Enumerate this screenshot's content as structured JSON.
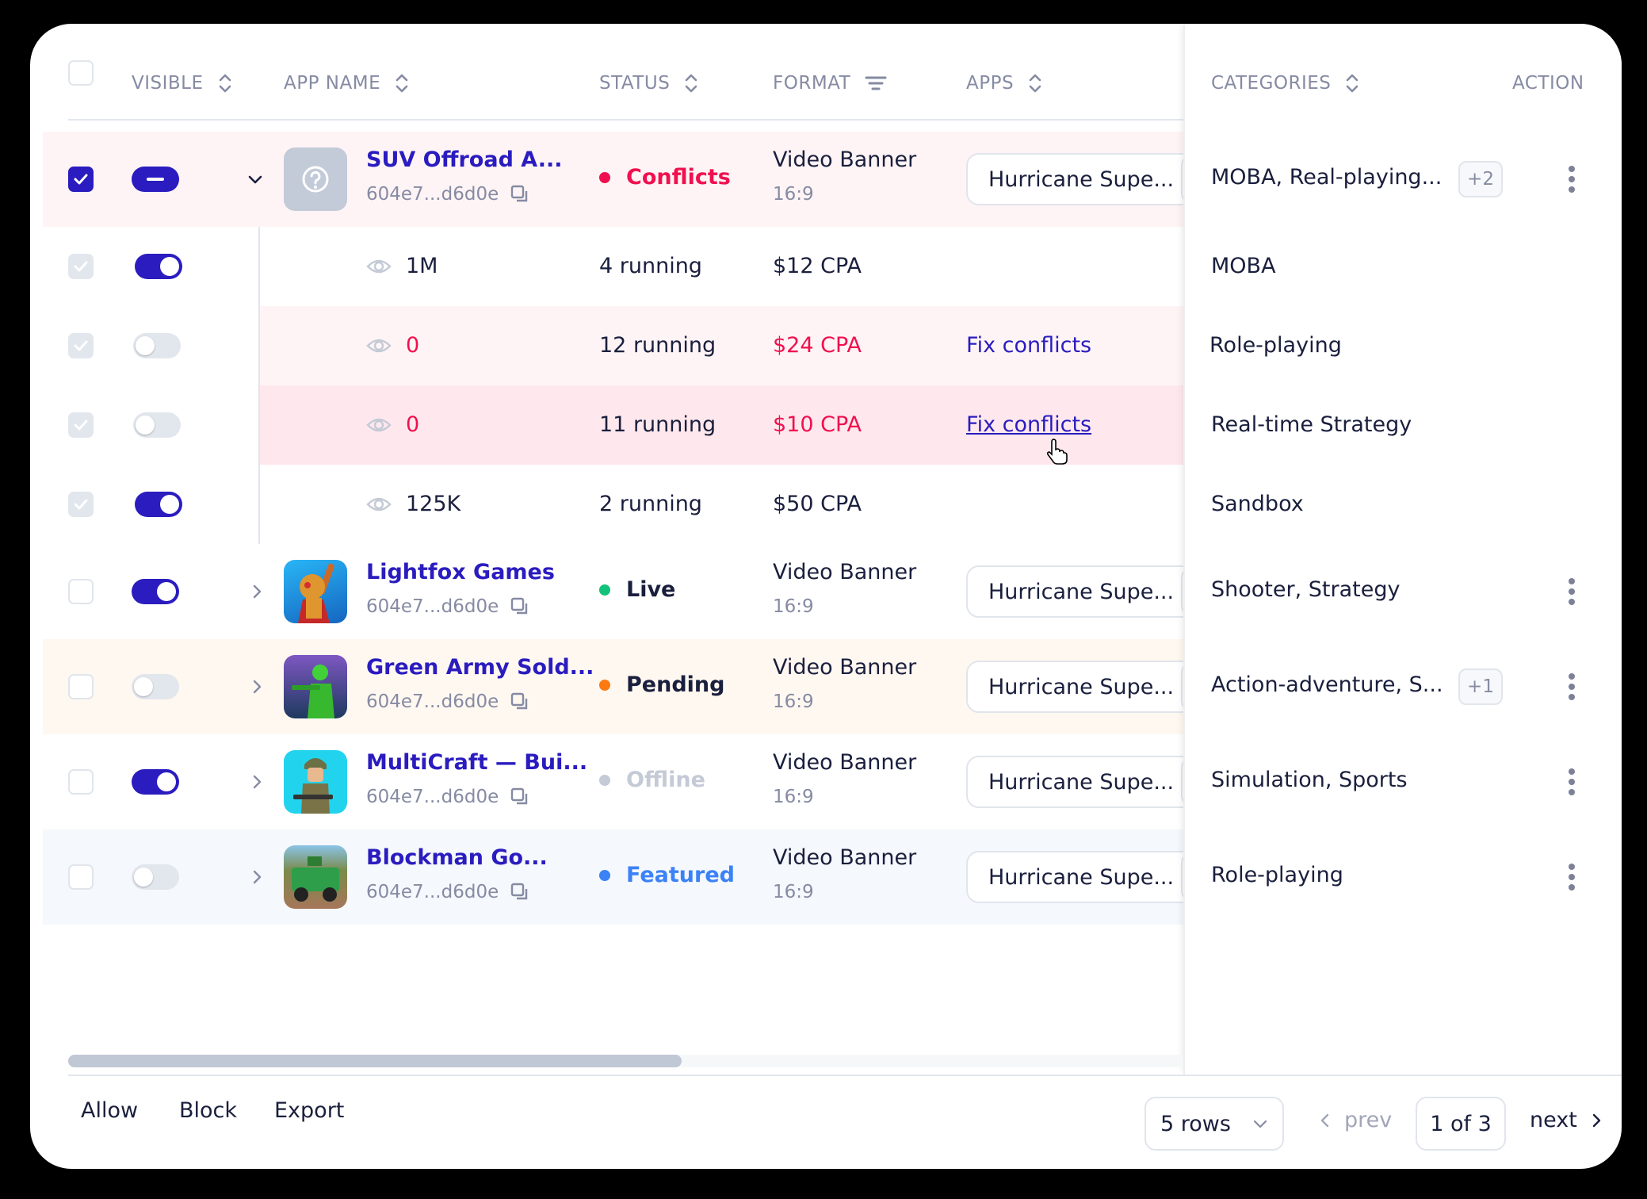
{
  "colors": {
    "accent": "#2a1cbf",
    "conflict": "#f0104f",
    "live": "#13c27a",
    "pending": "#fb7a11",
    "offline": "#c4cad6",
    "featured": "#3b82f6",
    "muted": "#868ba3",
    "text": "#1a1f3d"
  },
  "header": {
    "visible": "VISIBLE",
    "app_name": "APP NAME",
    "status": "STATUS",
    "format": "FORMAT",
    "apps": "APPS",
    "categories": "CATEGORIES",
    "action": "ACTION"
  },
  "rows": [
    {
      "name": "SUV Offroad A...",
      "id": "604e7...d6d0e",
      "status": "Conflicts",
      "format": "Video Banner",
      "ratio": "16:9",
      "app": "Hurricane Supe...",
      "categories": "MOBA, Real-playing...",
      "extra": "+2",
      "selected": true,
      "visible": "indeterminate",
      "expanded": true,
      "icon": "placeholder-question"
    },
    {
      "name": "Lightfox Games",
      "id": "604e7...d6d0e",
      "status": "Live",
      "format": "Video Banner",
      "ratio": "16:9",
      "app": "Hurricane Supe...",
      "categories": "Shooter, Strategy",
      "extra": "",
      "selected": false,
      "visible": true,
      "expanded": false,
      "icon": "knight-hero"
    },
    {
      "name": "Green Army Sold...",
      "id": "604e7...d6d0e",
      "status": "Pending",
      "format": "Video Banner",
      "ratio": "16:9",
      "app": "Hurricane Supe...",
      "categories": "Action-adventure, S...",
      "extra": "+1",
      "selected": false,
      "visible": false,
      "expanded": false,
      "icon": "green-soldier"
    },
    {
      "name": "MultiCraft — Bui...",
      "id": "604e7...d6d0e",
      "status": "Offline",
      "format": "Video Banner",
      "ratio": "16:9",
      "app": "Hurricane Supe...",
      "categories": "Simulation, Sports",
      "extra": "",
      "selected": false,
      "visible": true,
      "expanded": false,
      "icon": "soldier-rifle"
    },
    {
      "name": "Blockman Go...",
      "id": "604e7...d6d0e",
      "status": "Featured",
      "format": "Video Banner",
      "ratio": "16:9",
      "app": "Hurricane Supe...",
      "categories": "Role-playing",
      "extra": "",
      "selected": false,
      "visible": false,
      "expanded": false,
      "icon": "camo-truck"
    }
  ],
  "subrows": [
    {
      "views": "1M",
      "running": "4 running",
      "cpa": "$12 CPA",
      "fix": "",
      "category": "MOBA",
      "visible": true,
      "conflict": false
    },
    {
      "views": "0",
      "running": "12 running",
      "cpa": "$24 CPA",
      "fix": "Fix conflicts",
      "category": "Role-playing",
      "visible": false,
      "conflict": true
    },
    {
      "views": "0",
      "running": "11 running",
      "cpa": "$10 CPA",
      "fix": "Fix conflicts",
      "category": "Real-time Strategy",
      "visible": false,
      "conflict": true,
      "hovered": true
    },
    {
      "views": "125K",
      "running": "2 running",
      "cpa": "$50 CPA",
      "fix": "",
      "category": "Sandbox",
      "visible": true,
      "conflict": false
    }
  ],
  "scroll": {
    "horizontal_position": 0.0,
    "visible_fraction": 0.55
  },
  "footer": {
    "allow": "Allow",
    "block": "Block",
    "export": "Export",
    "rows_per_page": "5 rows",
    "prev": "prev",
    "page": "1 of 3",
    "next": "next"
  }
}
